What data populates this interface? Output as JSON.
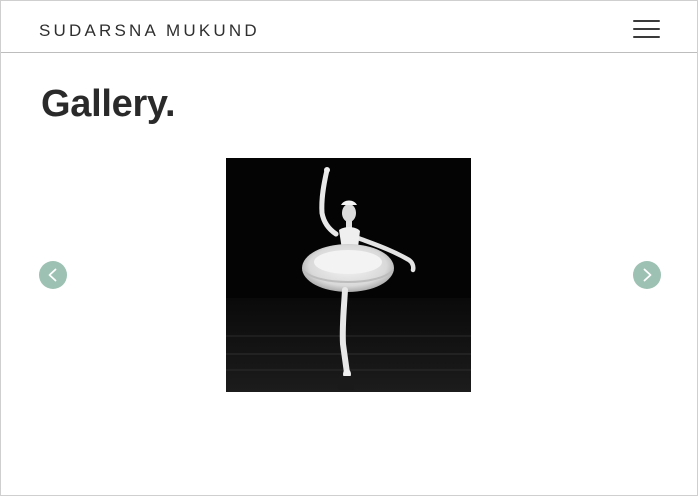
{
  "header": {
    "brand": "SUDARSNA MUKUND",
    "menu_icon": "hamburger-menu-icon"
  },
  "main": {
    "title": "Gallery."
  },
  "carousel": {
    "prev_icon": "chevron-left-icon",
    "next_icon": "chevron-right-icon",
    "arrow_color": "#9dc1b3",
    "slide": {
      "subject": "ballerina-photo",
      "style": "black-and-white"
    }
  },
  "colors": {
    "text": "#2a2a2a",
    "border": "#bdbdbd",
    "background": "#ffffff"
  }
}
